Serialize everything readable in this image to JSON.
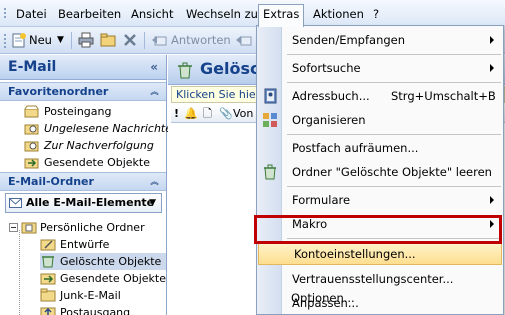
{
  "menubar": {
    "items": [
      {
        "label": "Datei"
      },
      {
        "label": "Bearbeiten"
      },
      {
        "label": "Ansicht"
      },
      {
        "label": "Wechseln zu"
      },
      {
        "label": "Extras"
      },
      {
        "label": "Aktionen"
      },
      {
        "label": "?"
      }
    ]
  },
  "toolbar": {
    "new_label": "Neu",
    "reply_label": "Antworten"
  },
  "nav": {
    "title": "E-Mail",
    "favorites_header": "Favoritenordner",
    "favorites": [
      {
        "label": "Posteingang"
      },
      {
        "label": "Ungelesene Nachrichten"
      },
      {
        "label": "Zur Nachverfolgung"
      },
      {
        "label": "Gesendete Objekte"
      }
    ],
    "mail_folders_header": "E-Mail-Ordner",
    "all_items": "Alle E-Mail-Elemente",
    "tree": [
      {
        "label": "Persönliche Ordner"
      },
      {
        "label": "Entwürfe"
      },
      {
        "label": "Gelöschte Objekte"
      },
      {
        "label": "Gesendete Objekte"
      },
      {
        "label": "Junk-E-Mail"
      },
      {
        "label": "Postausgang"
      }
    ]
  },
  "main": {
    "title": "Gelösch",
    "infobar": "Klicken Sie hier,",
    "col_von": "Von"
  },
  "extras_menu": {
    "items": [
      {
        "label": "Senden/Empfangen"
      },
      {
        "label": "Sofortsuche"
      },
      {
        "label": "Adressbuch...",
        "shortcut": "Strg+Umschalt+B"
      },
      {
        "label": "Organisieren"
      },
      {
        "label": "Postfach aufräumen..."
      },
      {
        "label": "Ordner \"Gelöschte Objekte\" leeren"
      },
      {
        "label": "Formulare"
      },
      {
        "label": "Makro"
      },
      {
        "label": "Kontoeinstellungen..."
      },
      {
        "label": "Vertrauensstellungscenter..."
      },
      {
        "label": "Anpassen..."
      },
      {
        "label": "Optionen..."
      }
    ]
  },
  "colors": {
    "highlight_border": "#c00000",
    "header_text": "#15428b"
  }
}
